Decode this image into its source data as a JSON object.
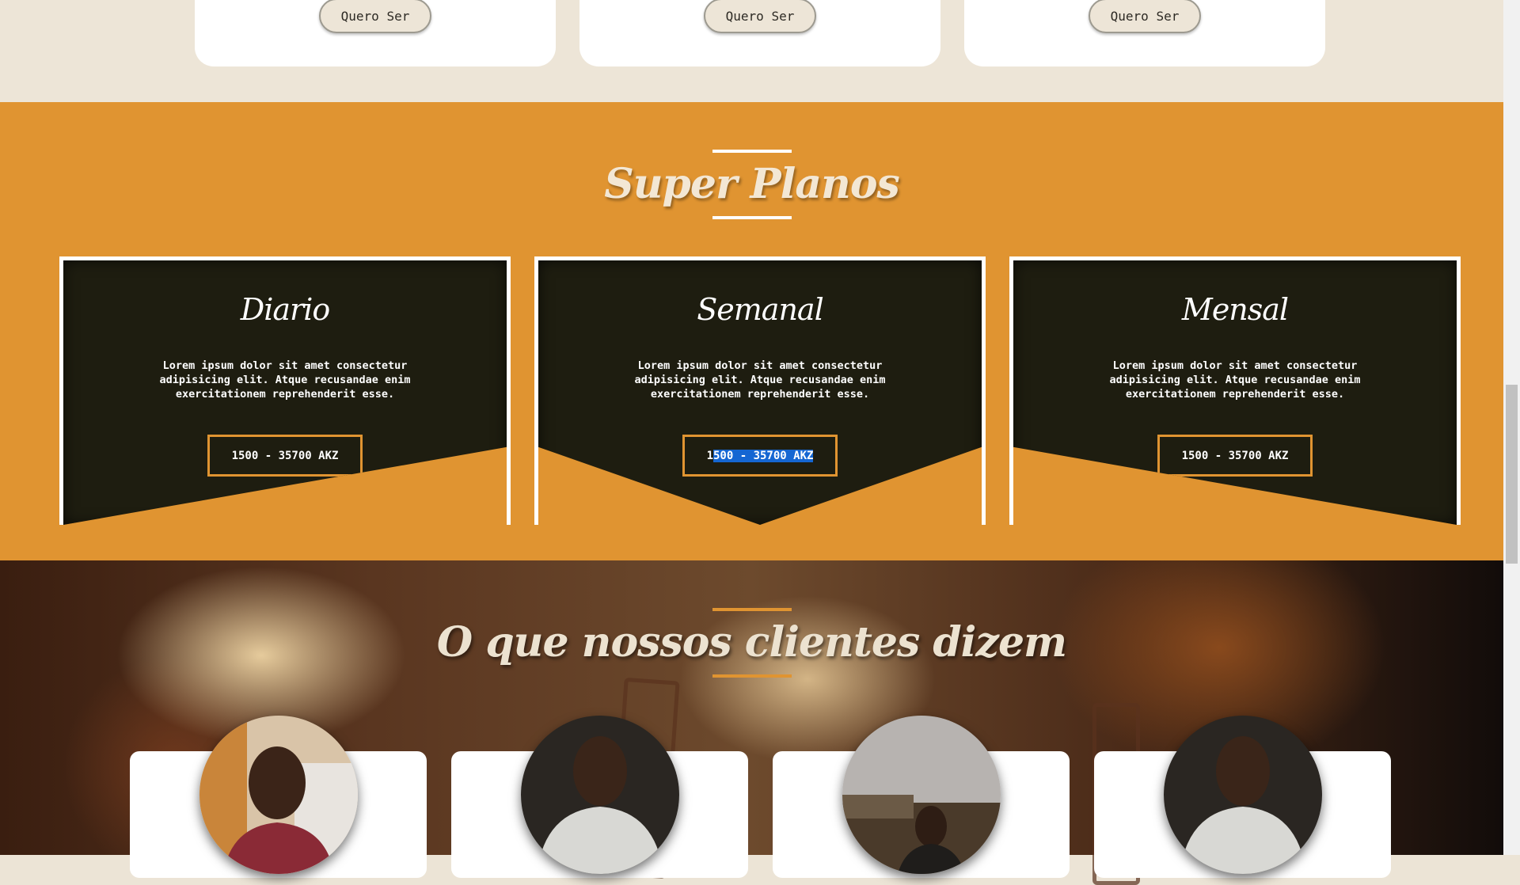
{
  "top_cards": {
    "items": [
      {
        "cta_label": "Quero Ser"
      },
      {
        "cta_label": "Quero Ser"
      },
      {
        "cta_label": "Quero Ser"
      }
    ]
  },
  "plans": {
    "heading": "Super Planos",
    "items": [
      {
        "title": "Diario",
        "description": "Lorem ipsum dolor sit amet consectetur adipisicing elit. Atque recusandae enim exercitationem reprehenderit esse.",
        "price": "1500 - 35700 AKZ"
      },
      {
        "title": "Semanal",
        "description": "Lorem ipsum dolor sit amet consectetur adipisicing elit. Atque recusandae enim exercitationem reprehenderit esse.",
        "price_prefix": "1",
        "price_selected": "500 - 35700 AKZ"
      },
      {
        "title": "Mensal",
        "description": "Lorem ipsum dolor sit amet consectetur adipisicing elit. Atque recusandae enim exercitationem reprehenderit esse.",
        "price": "1500 - 35700 AKZ"
      }
    ]
  },
  "testimonials": {
    "heading": "O que nossos clientes dizem"
  },
  "colors": {
    "accent_orange": "#e09431",
    "panel_dark": "#1e1d10",
    "cream": "#ede5d7",
    "selection_blue": "#1566d2"
  },
  "icons": {
    "avatars": [
      "avatar-photo",
      "avatar-photo",
      "avatar-photo",
      "avatar-photo"
    ]
  }
}
